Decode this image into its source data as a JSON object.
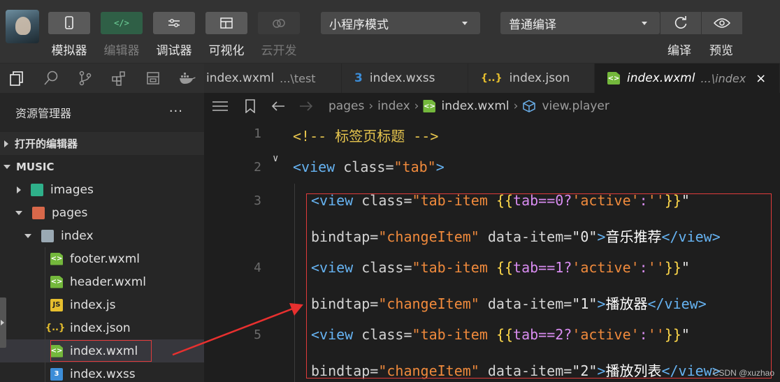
{
  "toolbar": {
    "tools": [
      {
        "label": "模拟器",
        "icon": "phone-icon"
      },
      {
        "label": "编辑器",
        "icon": "code-icon"
      },
      {
        "label": "调试器",
        "icon": "sliders-icon"
      },
      {
        "label": "可视化",
        "icon": "layout-icon"
      },
      {
        "label": "云开发",
        "icon": "cloud-icon"
      }
    ],
    "mode_select": "小程序模式",
    "compile_select": "普通编译",
    "compile_label": "编译",
    "preview_label": "预览"
  },
  "explorer": {
    "title": "资源管理器",
    "more": "···",
    "sections": [
      "打开的编辑器",
      "MUSIC"
    ],
    "items": [
      {
        "label": "images"
      },
      {
        "label": "pages"
      },
      {
        "label": "index"
      },
      {
        "label": "footer.wxml"
      },
      {
        "label": "header.wxml"
      },
      {
        "label": "index.js"
      },
      {
        "label": "index.json"
      },
      {
        "label": "index.wxml"
      },
      {
        "label": "index.wxss"
      }
    ]
  },
  "tabs": [
    {
      "label": "index.wxml",
      "hint": "...\\test"
    },
    {
      "label": "index.wxss"
    },
    {
      "label": "index.json"
    },
    {
      "label": "index.wxml",
      "hint": "...\\index",
      "close": "×"
    }
  ],
  "breadcrumb": [
    "pages",
    "index",
    "index.wxml",
    "view.player"
  ],
  "editor": {
    "line_numbers": [
      "1",
      "2",
      "3",
      "4",
      "5"
    ],
    "line1": {
      "comment": "<!-- 标签页标题 -->"
    },
    "line2": {
      "open": "<view",
      "attr": " class=",
      "value": "\"tab\"",
      "close": ">"
    },
    "items": [
      {
        "tab_index": "0",
        "data_item": "\"0\"",
        "text": "音乐推荐"
      },
      {
        "tab_index": "1",
        "data_item": "\"1\"",
        "text": "播放器"
      },
      {
        "tab_index": "2",
        "data_item": "\"2\"",
        "text": "播放列表"
      }
    ],
    "tok": {
      "view_open": "<view",
      "class_attr": " class=",
      "q": "\"",
      "tab_item": "tab-item ",
      "lb": "{{",
      "rb": "}}",
      "tab_eq": "tab==",
      "q_active": "?",
      "active": "'active'",
      "colon": ":",
      "empty": "''",
      "bindtap": "bindtap=",
      "handler": "\"changeItem\"",
      "data_attr": " data-item=",
      "gt": ">",
      "view_close": "</view>"
    }
  },
  "watermark": "CSDN @xuzhao"
}
